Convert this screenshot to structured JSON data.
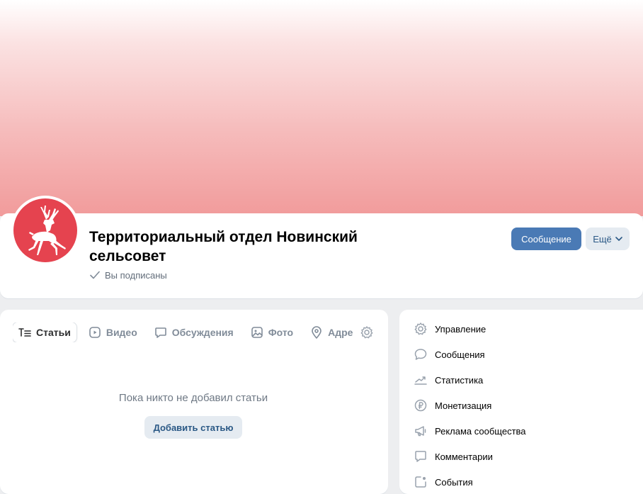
{
  "community": {
    "name": "Территориальный отдел Новинский сельсовет",
    "status": "Вы подписаны"
  },
  "actions": {
    "message_label": "Сообщение",
    "more_label": "Ещё"
  },
  "tabs": [
    {
      "label": "Статьи",
      "icon": "articles-icon",
      "active": true
    },
    {
      "label": "Видео",
      "icon": "video-icon",
      "active": false
    },
    {
      "label": "Обсуждения",
      "icon": "discussions-icon",
      "active": false
    },
    {
      "label": "Фото",
      "icon": "photo-icon",
      "active": false
    },
    {
      "label": "Адрес",
      "icon": "location-icon",
      "active": false
    }
  ],
  "empty_state": {
    "text": "Пока никто не добавил статьи",
    "button_label": "Добавить статью"
  },
  "side_menu": [
    {
      "label": "Управление",
      "icon": "gear-icon"
    },
    {
      "label": "Сообщения",
      "icon": "message-bubble-icon"
    },
    {
      "label": "Статистика",
      "icon": "chart-trend-icon"
    },
    {
      "label": "Монетизация",
      "icon": "ruble-icon"
    },
    {
      "label": "Реклама сообщества",
      "icon": "megaphone-icon"
    },
    {
      "label": "Комментарии",
      "icon": "comment-icon"
    },
    {
      "label": "События",
      "icon": "event-icon"
    }
  ],
  "colors": {
    "accent": "#4a7ab5",
    "avatar_bg": "#e5434f",
    "secondary_button_bg": "#e5ebf1"
  }
}
